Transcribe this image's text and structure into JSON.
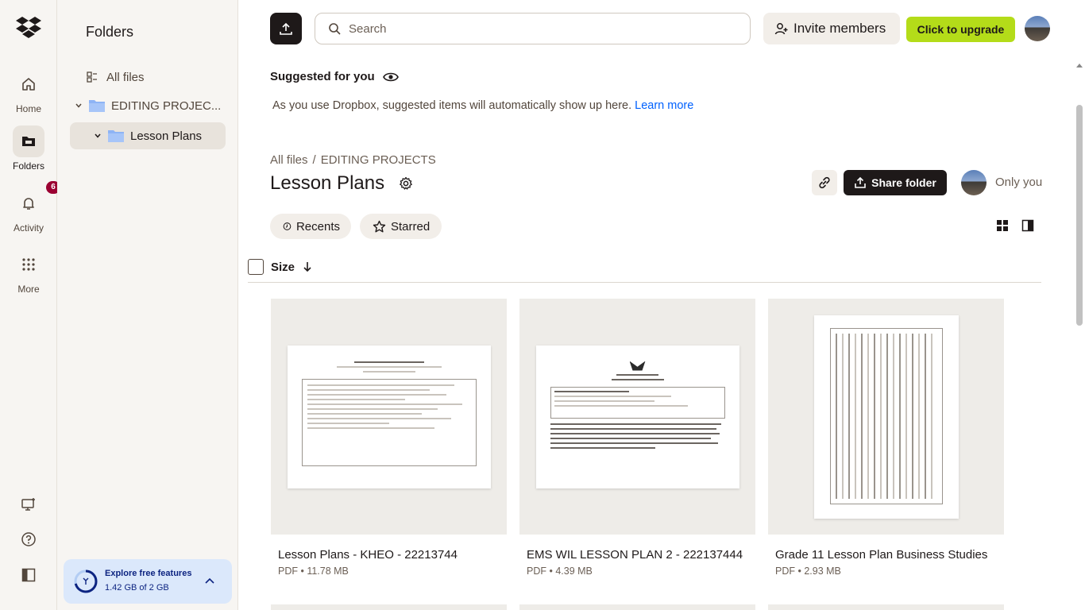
{
  "rail": {
    "logo_icon": "dropbox-logo-icon",
    "items": [
      {
        "label": "Home",
        "icon": "home-icon"
      },
      {
        "label": "Folders",
        "icon": "folder-icon"
      },
      {
        "label": "Activity",
        "icon": "bell-icon",
        "badge": "6"
      },
      {
        "label": "More",
        "icon": "grid-dots-icon"
      }
    ],
    "bottom_icons": [
      "desktop-icon",
      "help-icon",
      "panel-toggle-icon"
    ]
  },
  "tree": {
    "title": "Folders",
    "all_files": "All files",
    "items": [
      {
        "label": "EDITING PROJEC..."
      },
      {
        "label": "Lesson Plans"
      }
    ],
    "explore": {
      "title": "Explore free features",
      "usage": "1.42 GB of 2 GB"
    }
  },
  "topbar": {
    "search_placeholder": "Search",
    "invite_label": "Invite members",
    "upgrade_label": "Click to upgrade"
  },
  "suggested": {
    "title": "Suggested for you",
    "text": "As you use Dropbox, suggested items will automatically show up here.",
    "link": "Learn more"
  },
  "breadcrumb": {
    "root": "All files",
    "sep": "/",
    "parent": "EDITING PROJECTS"
  },
  "folder": {
    "title": "Lesson Plans",
    "share_label": "Share folder",
    "access": "Only you"
  },
  "filters": {
    "recents": "Recents",
    "starred": "Starred"
  },
  "sort": {
    "label": "Size"
  },
  "files": [
    {
      "name": "Lesson Plans - KHEO - 22213744",
      "meta": "PDF • 11.78 MB"
    },
    {
      "name": "EMS WIL LESSON PLAN 2 - 222137444",
      "meta": "PDF • 4.39 MB"
    },
    {
      "name": "Grade 11 Lesson Plan Business Studies",
      "meta": "PDF • 2.93 MB"
    }
  ],
  "colors": {
    "accent": "#0061fe",
    "upgrade": "#b4dc19",
    "badge": "#9b0032"
  }
}
